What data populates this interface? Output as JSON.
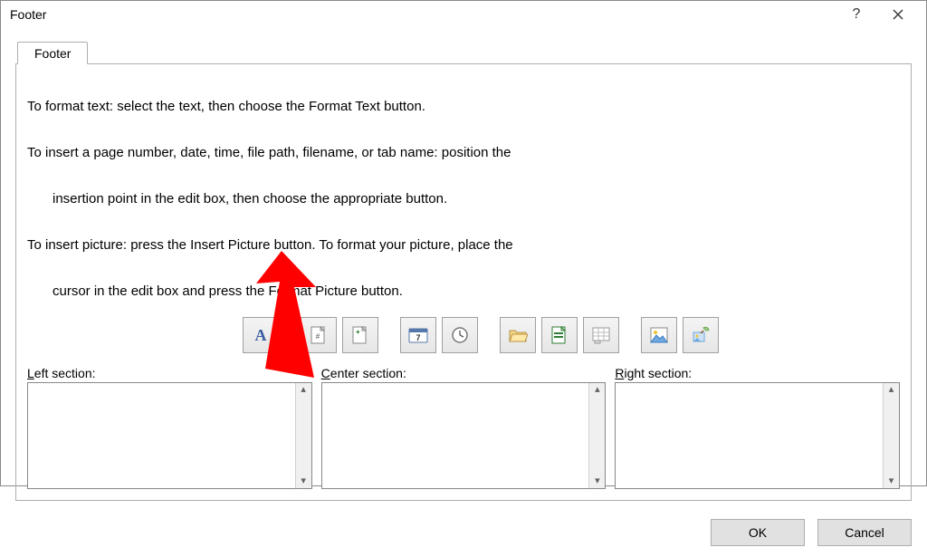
{
  "window": {
    "title": "Footer"
  },
  "tab": {
    "label": "Footer"
  },
  "instructions": {
    "line1": "To format text:  select the text, then choose the Format Text button.",
    "line2": "To insert a page number, date, time, file path, filename, or tab name:  position the",
    "line2b": "insertion point in the edit box, then choose the appropriate button.",
    "line3": "To insert picture: press the Insert Picture button.  To format your picture, place the",
    "line3b": "cursor in the edit box and press the Format Picture button."
  },
  "toolbar": {
    "format_text": "Format Text",
    "page_number": "Insert Page Number",
    "pages": "Insert Number of Pages",
    "date": "Insert Date",
    "time": "Insert Time",
    "file_path": "Insert File Path",
    "file_name": "Insert File Name",
    "sheet_name": "Insert Sheet Name",
    "picture": "Insert Picture",
    "format_picture": "Format Picture"
  },
  "sections": {
    "left_label_u": "L",
    "left_label_rest": "eft section:",
    "center_label_u": "C",
    "center_label_rest": "enter section:",
    "right_label_u": "R",
    "right_label_rest": "ight section:",
    "left_value": "",
    "center_value": "",
    "right_value": ""
  },
  "buttons": {
    "ok": "OK",
    "cancel": "Cancel"
  }
}
